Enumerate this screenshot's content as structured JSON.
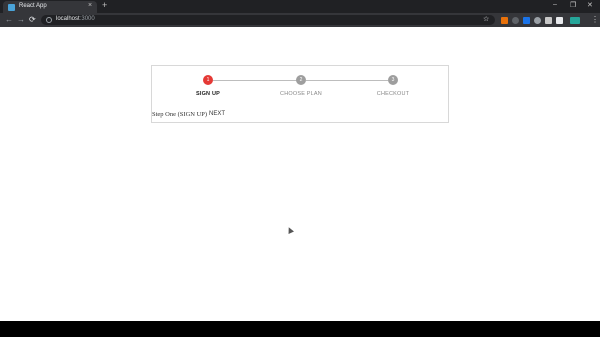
{
  "browser": {
    "tab_title": "React App",
    "tab_close": "×",
    "new_tab": "+",
    "url_host": "localhost",
    "url_port": ":3000",
    "window_controls": [
      "–",
      "❐",
      "✕"
    ],
    "nav": {
      "back": "←",
      "forward": "→",
      "reload": "⟳"
    },
    "star": "☆",
    "menu": "⋮"
  },
  "wizard": {
    "steps": [
      {
        "number": "1",
        "label": "SIGN UP",
        "active": true
      },
      {
        "number": "2",
        "label": "CHOOSE PLAN",
        "active": false
      },
      {
        "number": "3",
        "label": "CHECKOUT",
        "active": false
      }
    ],
    "content": "Step One (SIGN UP)",
    "next_label": "NEXT"
  },
  "colors": {
    "active_step": "#e53935",
    "inactive_step": "#9e9e9e",
    "tab_bar": "#202124",
    "toolbar": "#35363a"
  }
}
